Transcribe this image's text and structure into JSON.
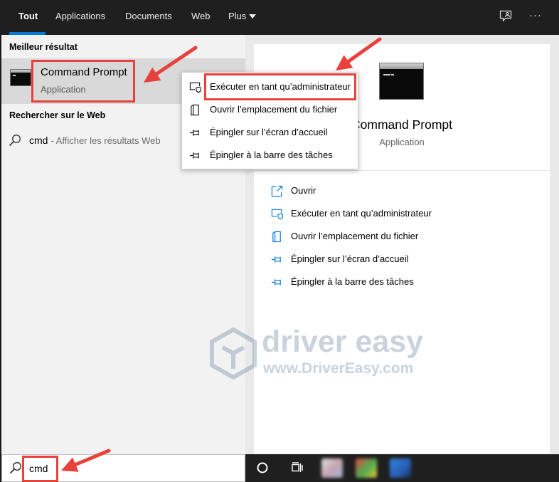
{
  "header": {
    "tabs": [
      {
        "label": "Tout",
        "active": true
      },
      {
        "label": "Applications",
        "active": false
      },
      {
        "label": "Documents",
        "active": false
      },
      {
        "label": "Web",
        "active": false
      },
      {
        "label": "Plus",
        "active": false,
        "dropdown": true
      }
    ],
    "feedback_icon": "feedback-icon",
    "more_glyph": "···"
  },
  "left_pane": {
    "best_result_heading": "Meilleur résultat",
    "best_result": {
      "icon": "command-prompt-icon",
      "title": "Command Prompt",
      "subtitle": "Application"
    },
    "web_heading": "Rechercher sur le Web",
    "web_result": {
      "icon": "search-icon",
      "query": "cmd",
      "suffix": "- Afficher les résultats Web"
    }
  },
  "context_menu": {
    "items": [
      {
        "icon": "run-as-admin-icon",
        "label": "Exécuter en tant qu’administrateur"
      },
      {
        "icon": "file-location-icon",
        "label": "Ouvrir l’emplacement du fichier"
      },
      {
        "icon": "pin-icon",
        "label": "Épingler sur l’écran d’accueil"
      },
      {
        "icon": "pin-icon",
        "label": "Épingler à la barre des tâches"
      }
    ]
  },
  "preview": {
    "icon": "command-prompt-icon",
    "title": "Command Prompt",
    "subtitle": "Application",
    "actions": [
      {
        "icon": "open-icon",
        "label": "Ouvrir"
      },
      {
        "icon": "run-as-admin-icon",
        "label": "Exécuter en tant qu’administrateur"
      },
      {
        "icon": "file-location-icon",
        "label": "Ouvrir l’emplacement du fichier"
      },
      {
        "icon": "pin-icon",
        "label": "Épingler sur l’écran d’accueil"
      },
      {
        "icon": "pin-icon",
        "label": "Épingler à la barre des tâches"
      }
    ]
  },
  "search_box": {
    "icon": "search-icon",
    "value": "cmd"
  },
  "taskbar": {
    "icons": [
      "cortana-icon",
      "task-view-icon",
      "app-icon",
      "app-icon",
      "app-icon"
    ]
  },
  "watermark": {
    "brand": "driver easy",
    "url": "www.DriverEasy.com"
  },
  "colors": {
    "accent": "#0078d7",
    "annotation": "#e8413c",
    "header_bg": "#1f1f1f",
    "taskbar_bg": "#1f1f1f",
    "list_bg": "#f2f2f2",
    "selected_bg": "#d9d9d9",
    "preview_bg": "#e9e9e9"
  }
}
